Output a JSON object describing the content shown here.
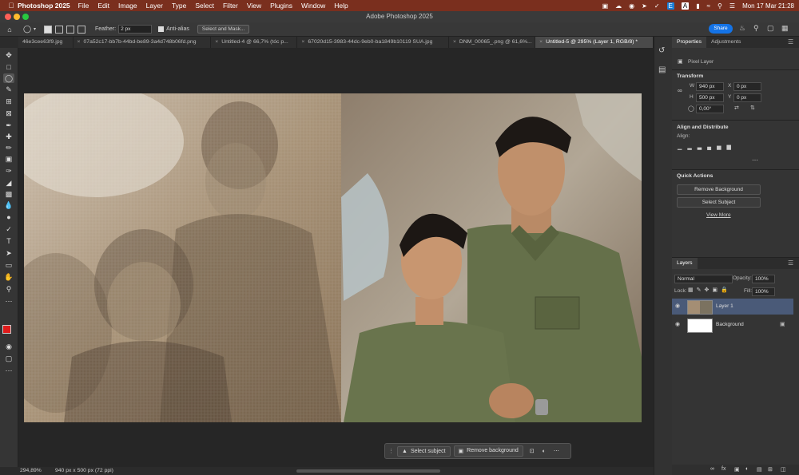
{
  "menubar": {
    "app": "Photoshop 2025",
    "items": [
      "File",
      "Edit",
      "Image",
      "Layer",
      "Type",
      "Select",
      "Filter",
      "View",
      "Plugins",
      "Window",
      "Help"
    ],
    "datetime": "Mon 17 Mar  21:28",
    "status_icon_e": "E",
    "status_icon_a": "A"
  },
  "window": {
    "title": "Adobe Photoshop 2025"
  },
  "options": {
    "feather_label": "Feather:",
    "feather_value": "2 px",
    "antialias_label": "Anti-alias",
    "select_mask_label": "Select and Mask...",
    "share_label": "Share"
  },
  "tabs": [
    {
      "label": "46e3cee63f9.jpg"
    },
    {
      "label": "07a52c17-bb7b-44bd-be89-3a4d748b06fd.png"
    },
    {
      "label": "Untitled-4 @ 66,7% (tóc p..."
    },
    {
      "label": "67020d15-3983-44dc-9eb0-ba1849b10119 SUA.jpg"
    },
    {
      "label": "DNM_00065_.png @ 61,6%..."
    },
    {
      "label": "Untitled-5 @ 295% (Layer 1, RGB/8) *"
    }
  ],
  "properties": {
    "tab_properties": "Properties",
    "tab_adjustments": "Adjustments",
    "kind": "Pixel Layer",
    "transform_title": "Transform",
    "w_label": "W",
    "w_value": "940 px",
    "h_label": "H",
    "h_value": "500 px",
    "x_label": "X",
    "x_value": "0 px",
    "y_label": "Y",
    "y_value": "0 px",
    "angle_value": "0,00°",
    "align_title": "Align and Distribute",
    "align_label": "Align:",
    "quick_title": "Quick Actions",
    "remove_bg": "Remove Background",
    "select_subject": "Select Subject",
    "view_more": "View More"
  },
  "layers": {
    "title": "Layers",
    "blend_mode": "Normal",
    "opacity_label": "Opacity:",
    "opacity_value": "100%",
    "lock_label": "Lock:",
    "fill_label": "Fill:",
    "fill_value": "100%",
    "items": [
      {
        "name": "Layer 1"
      },
      {
        "name": "Background"
      }
    ]
  },
  "status": {
    "zoom": "294,89%",
    "doc_info": "940 px x 500 px (72 ppi)"
  },
  "taskbar": {
    "select_subject": "Select subject",
    "remove_background": "Remove background"
  },
  "colors": {
    "foreground": "#e01b1b",
    "background": "#ffffff",
    "accent": "#1473e6"
  }
}
